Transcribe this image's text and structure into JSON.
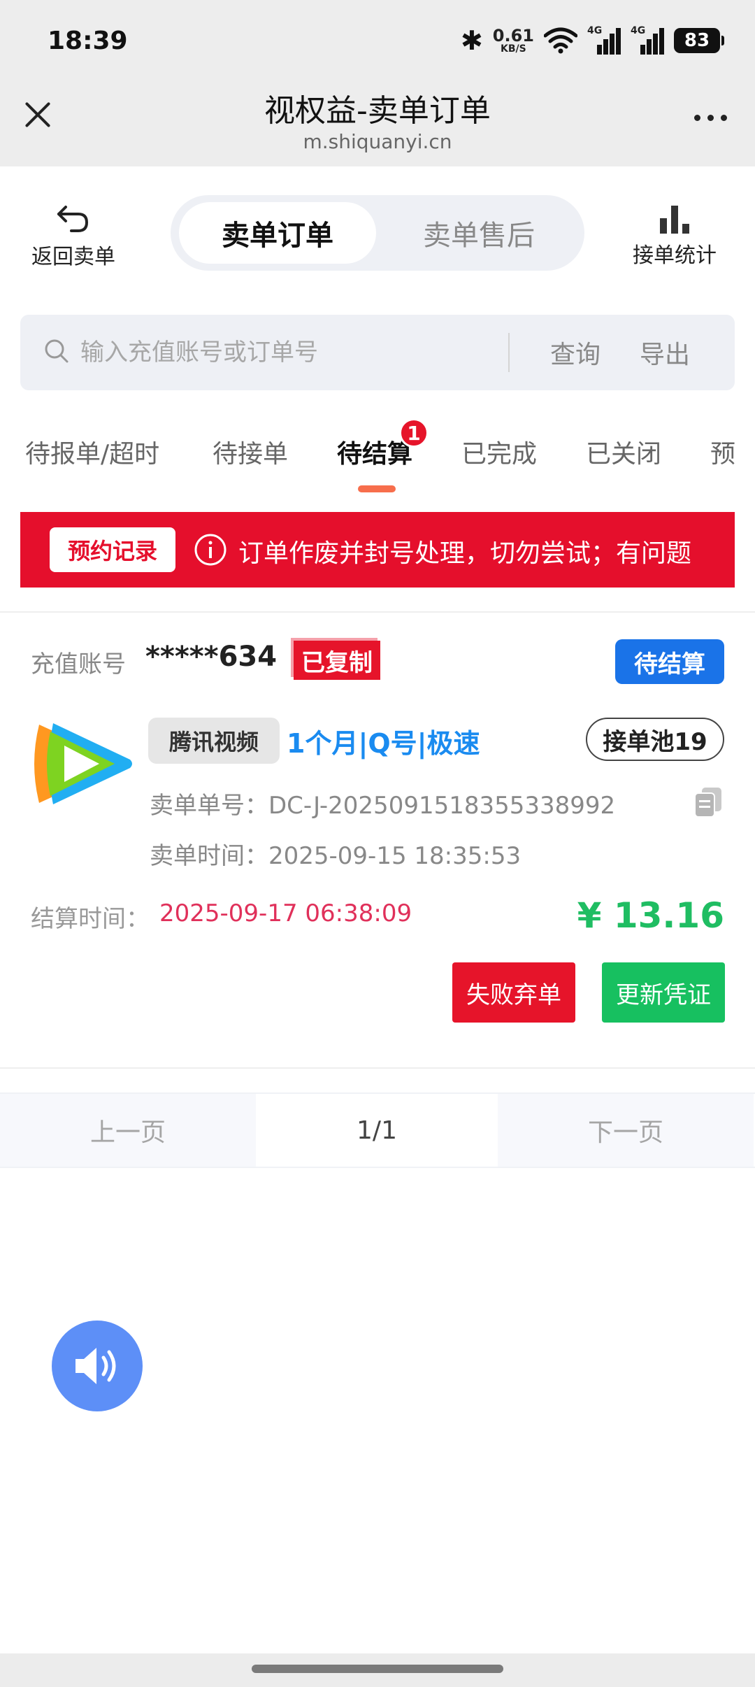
{
  "status_bar": {
    "time": "18:39",
    "net_speed": "0.61",
    "net_unit": "KB/S",
    "sig1_label": "4G",
    "sig2_label": "4G",
    "battery": "83"
  },
  "header": {
    "title": "视权益-卖单订单",
    "url": "m.shiquanyi.cn"
  },
  "toolbar": {
    "back_label": "返回卖单",
    "segment_active": "卖单订单",
    "segment_inactive": "卖单售后",
    "stats_label": "接单统计"
  },
  "search": {
    "placeholder": "输入充值账号或订单号",
    "query_label": "查询",
    "export_label": "导出"
  },
  "tabs": {
    "t1": "待报单/超时",
    "t2": "待接单",
    "t3": "待结算",
    "t4": "已完成",
    "t5": "已关闭",
    "t6": "预",
    "badge": "1"
  },
  "notice": {
    "record_label": "预约记录",
    "message": "订单作废并封号处理，切勿尝试；有问题"
  },
  "order": {
    "account_label": "充值账号",
    "account_value": "*****634",
    "copied_label": "已复制",
    "status": "待结算",
    "platform": "腾讯视频",
    "product": "1个月|Q号|极速",
    "pool": "接单池19",
    "order_no_line": "卖单单号：DC-J-2025091518355338992",
    "order_time_line": "卖单时间：2025-09-15 18:35:53",
    "settle_label": "结算时间：",
    "settle_time": "2025-09-17 06:38:09",
    "amount": "¥ 13.16",
    "fail_button": "失败弃单",
    "update_button": "更新凭证"
  },
  "pagination": {
    "prev": "上一页",
    "page": "1/1",
    "next": "下一页"
  },
  "colors": {
    "accent_red": "#e6142a",
    "accent_blue": "#1a73e8",
    "accent_green": "#17c060",
    "tab_indicator": "#f76e4c"
  }
}
